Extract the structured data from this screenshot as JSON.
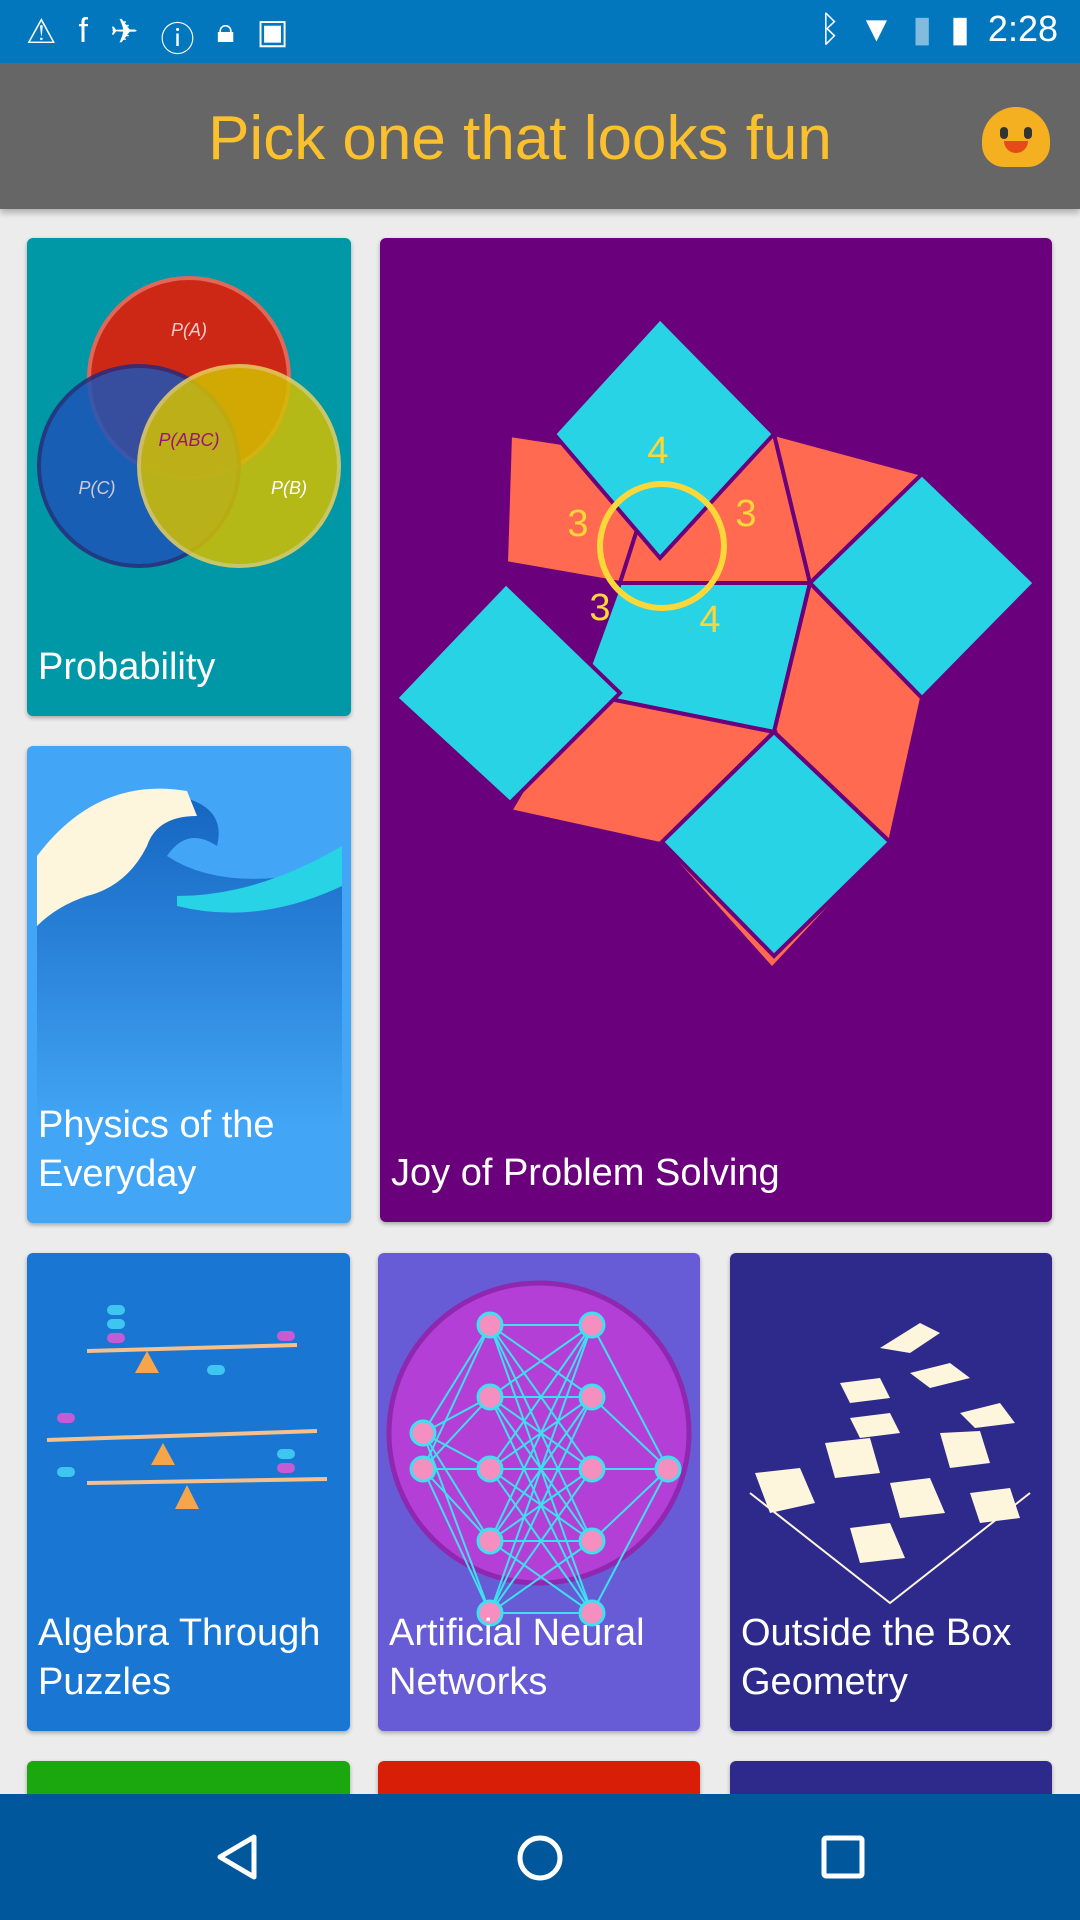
{
  "status_bar": {
    "time": "2:28",
    "left_icons": [
      "warning-icon",
      "facebook-icon",
      "fake-gps-icon",
      "info-icon",
      "lock-icon",
      "android-icon"
    ],
    "right_icons": [
      "bluetooth-icon",
      "wifi-icon",
      "no-sim-icon",
      "battery-charging-icon"
    ]
  },
  "app_bar": {
    "title": "Pick one that looks fun",
    "emoji_icon": "smiley-icon"
  },
  "courses": [
    {
      "label": "Probability",
      "color": "#0097a7",
      "venn": [
        "P(A)",
        "P(B)",
        "P(C)",
        "P(ABC)"
      ]
    },
    {
      "label": "Joy of Problem Solving",
      "color": "#6a007c",
      "numbers": [
        "4",
        "3",
        "3",
        "3",
        "4"
      ]
    },
    {
      "label": "Physics of the Everyday",
      "color": "#42a5f5"
    },
    {
      "label": "Algebra Through Puzzles",
      "color": "#1976d2"
    },
    {
      "label": "Artificial Neural Networks",
      "color": "#675bd6"
    },
    {
      "label": "Outside the Box Geometry",
      "color": "#2e2a8c"
    },
    {
      "label": "",
      "color": "#1aa80e"
    },
    {
      "label": "",
      "color": "#d81e06"
    },
    {
      "label": "",
      "color": "#2e2a8c"
    }
  ],
  "nav_bar": {
    "back": "back-icon",
    "home": "home-icon",
    "recents": "recents-icon"
  }
}
